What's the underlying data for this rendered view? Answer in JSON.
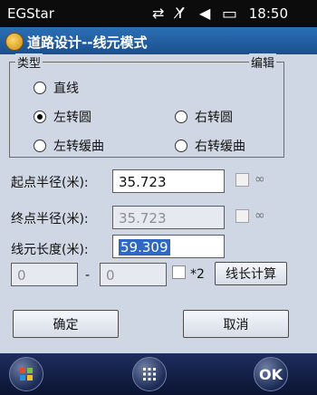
{
  "statusbar": {
    "carrier": "EGStar",
    "time": "18:50",
    "icons": {
      "connection": "sync-icon",
      "signal": "no-signal-icon",
      "volume": "volume-icon",
      "battery": "battery-icon"
    },
    "glyphs": {
      "sync": "⇄",
      "signal": "Y̸",
      "volume": "◀",
      "battery": "▭"
    }
  },
  "window": {
    "title": "道路设计--线元模式"
  },
  "type_group": {
    "label": "类型",
    "edit_label": "编辑",
    "options": [
      {
        "label": "直线",
        "selected": false
      },
      {
        "label": "左转圆",
        "selected": true
      },
      {
        "label": "右转圆",
        "selected": false
      },
      {
        "label": "左转缓曲",
        "selected": false
      },
      {
        "label": "右转缓曲",
        "selected": false
      }
    ]
  },
  "fields": {
    "start_radius": {
      "label": "起点半径(米):",
      "value": "35.723",
      "infinity_symbol": "∞",
      "infinity_checked": false
    },
    "end_radius": {
      "label": "终点半径(米):",
      "value": "35.723",
      "infinity_symbol": "∞",
      "infinity_checked": false
    },
    "length": {
      "label": "线元长度(米):",
      "value": "59.309"
    },
    "range_from": "0",
    "range_sep": "-",
    "range_to": "0",
    "times2_label": "*2",
    "calc_length_button": "线长计算"
  },
  "buttons": {
    "ok": "确定",
    "cancel": "取消"
  },
  "taskbar": {
    "start_icon": "windows-icon",
    "apps_icon": "grid-icon",
    "ok_label": "OK"
  }
}
